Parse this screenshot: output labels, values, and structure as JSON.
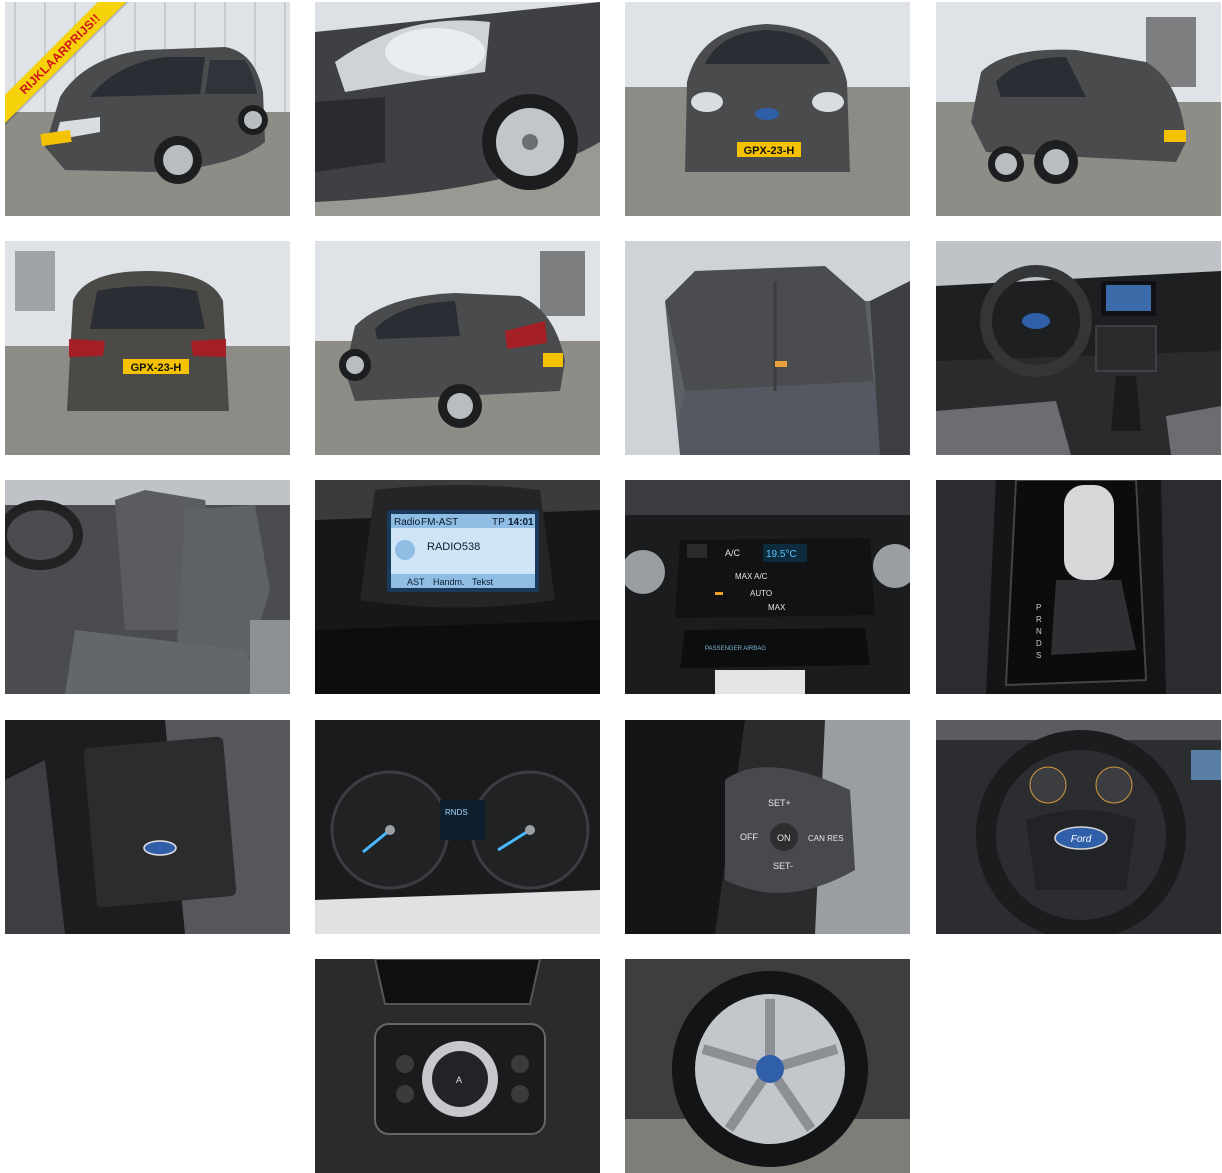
{
  "gallery": {
    "badge": "RIJKLAARPRIJS!!",
    "plate": "GPX-23-H",
    "radio": {
      "source": "Radio",
      "station_mode": "FM-AST",
      "tp": "TP",
      "time": "14:01",
      "station": "RADIO538",
      "softkeys": [
        "AST",
        "Handm.",
        "Tekst"
      ]
    },
    "climate": {
      "ac": "A/C",
      "temp": "19.5°C",
      "max_ac": "MAX A/C",
      "auto": "AUTO",
      "max": "MAX",
      "airbag": "PASSENGER AIRBAG"
    },
    "cruise": {
      "set_plus": "SET+",
      "off": "OFF",
      "on": "ON",
      "can_res": "CAN RES",
      "set_minus": "SET-"
    },
    "brand_badge": "Ford",
    "light_switch": {
      "auto_label": "A"
    },
    "gear_positions": [
      "P",
      "R",
      "N",
      "D",
      "S"
    ],
    "cluster_text": "RNDS",
    "colors": {
      "badge_bg": "#f6d20a",
      "badge_text": "#d0121b",
      "plate_bg": "#f4c200",
      "car_body": "#4a4b4d"
    }
  }
}
